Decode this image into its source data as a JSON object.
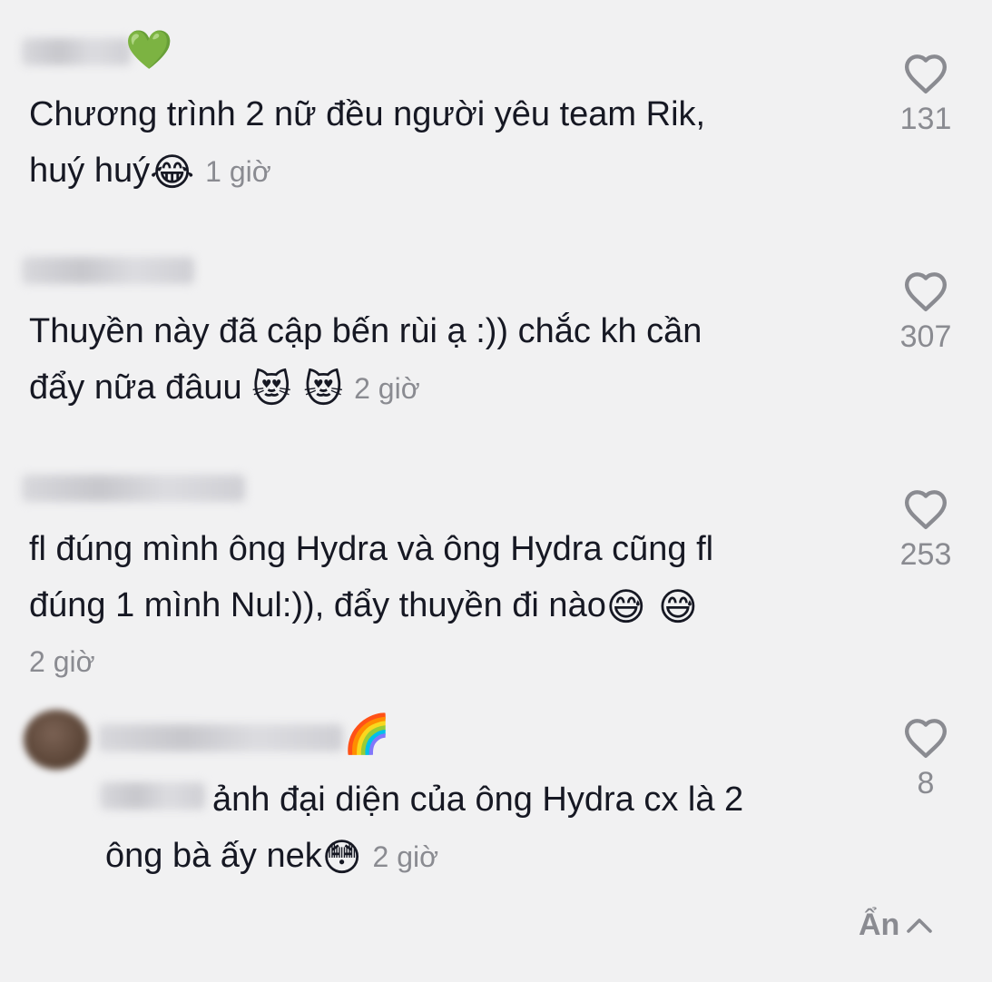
{
  "comments": [
    {
      "name_emoji": "💚",
      "line1": "Chương trình 2 nữ đều người yêu team Rik,",
      "line2": "huý huý",
      "line2_emoji": "😂",
      "time": "1 giờ",
      "likes": "131"
    },
    {
      "line1": "Thuyền này đã cập bến rùi ạ :)) chắc kh cần",
      "line2": "đẩy nữa đâuu ",
      "line2_emoji": "😻 😻",
      "time": "2 giờ",
      "likes": "307"
    },
    {
      "line1": "fl đúng mình ông Hydra và ông Hydra cũng fl",
      "line2": "đúng 1 mình Nul:)), đẩy thuyền đi nào",
      "line2_emoji": "😅 😅",
      "time": "2 giờ",
      "likes": "253"
    }
  ],
  "reply": {
    "name_emoji": "🌈",
    "line1": "ảnh đại diện của ông Hydra cx là 2",
    "line2": "ông bà ấy nek",
    "line2_emoji": "😳",
    "time": "2 giờ",
    "likes": "8"
  },
  "hide_label": "Ẩn",
  "icons": {
    "like": "heart-outline-icon",
    "hide": "chevron-up-icon"
  },
  "colors": {
    "background": "#f1f1f2",
    "text": "#161823",
    "muted": "#8a8b91"
  }
}
